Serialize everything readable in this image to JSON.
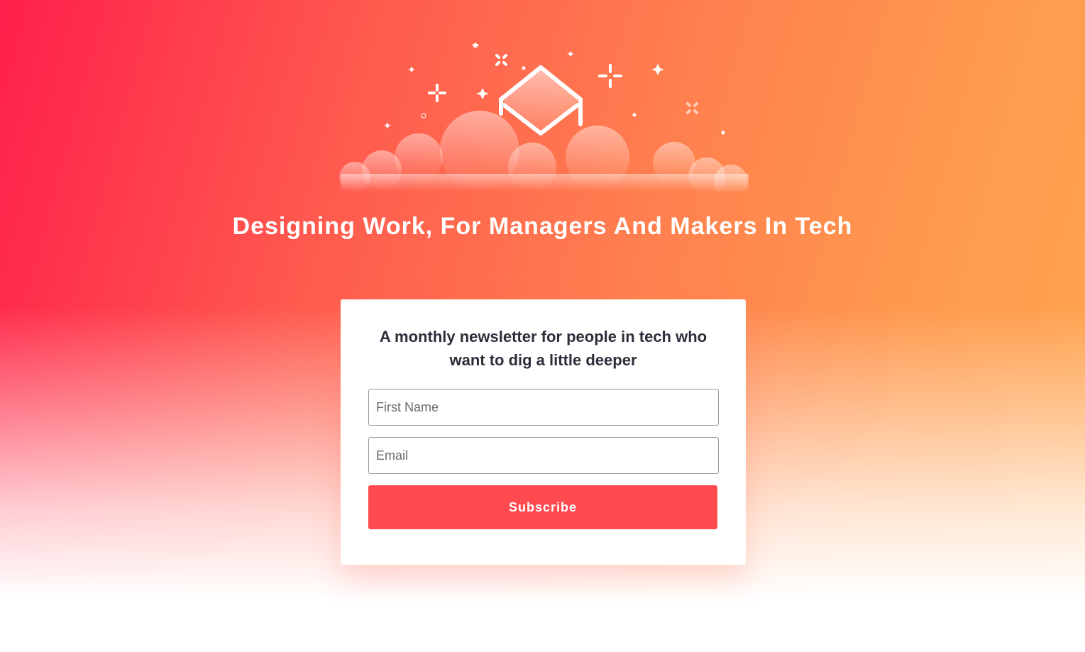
{
  "hero": {
    "headline": "Designing Work, For Managers And Makers In Tech",
    "illustration_icons": [
      "diamond-icon",
      "cloud-icon",
      "sparkle-icon",
      "plus-star-icon",
      "x-sparkle-icon",
      "dot-icon"
    ]
  },
  "signup": {
    "title": "A monthly newsletter for people in tech who want to dig a little deeper",
    "first_name_placeholder": "First Name",
    "email_placeholder": "Email",
    "subscribe_label": "Subscribe"
  },
  "colors": {
    "gradient_left": "#ff1f4b",
    "gradient_right": "#ffa64f",
    "button": "#ff4a50",
    "title_text": "#2c2f3a"
  }
}
